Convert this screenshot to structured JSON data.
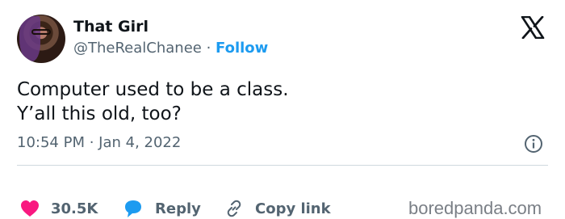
{
  "tweet": {
    "author_name": "That Girl",
    "handle": "@TheRealChanee",
    "separator": " · ",
    "follow_label": "Follow",
    "text_lines": [
      "Computer used to be a class.",
      "Y’all this old, too?"
    ],
    "timestamp": "10:54 PM · Jan 4, 2022"
  },
  "actions": {
    "likes": "30.5K",
    "reply_label": "Reply",
    "copy_label": "Copy link"
  },
  "watermark": "boredpanda.com",
  "colors": {
    "accent": "#1d9bf0",
    "like": "#f91880",
    "text": "#0f1419",
    "muted": "#536471"
  },
  "icons": [
    "x-logo-icon",
    "info-icon",
    "heart-icon",
    "reply-bubble-icon",
    "link-icon"
  ]
}
